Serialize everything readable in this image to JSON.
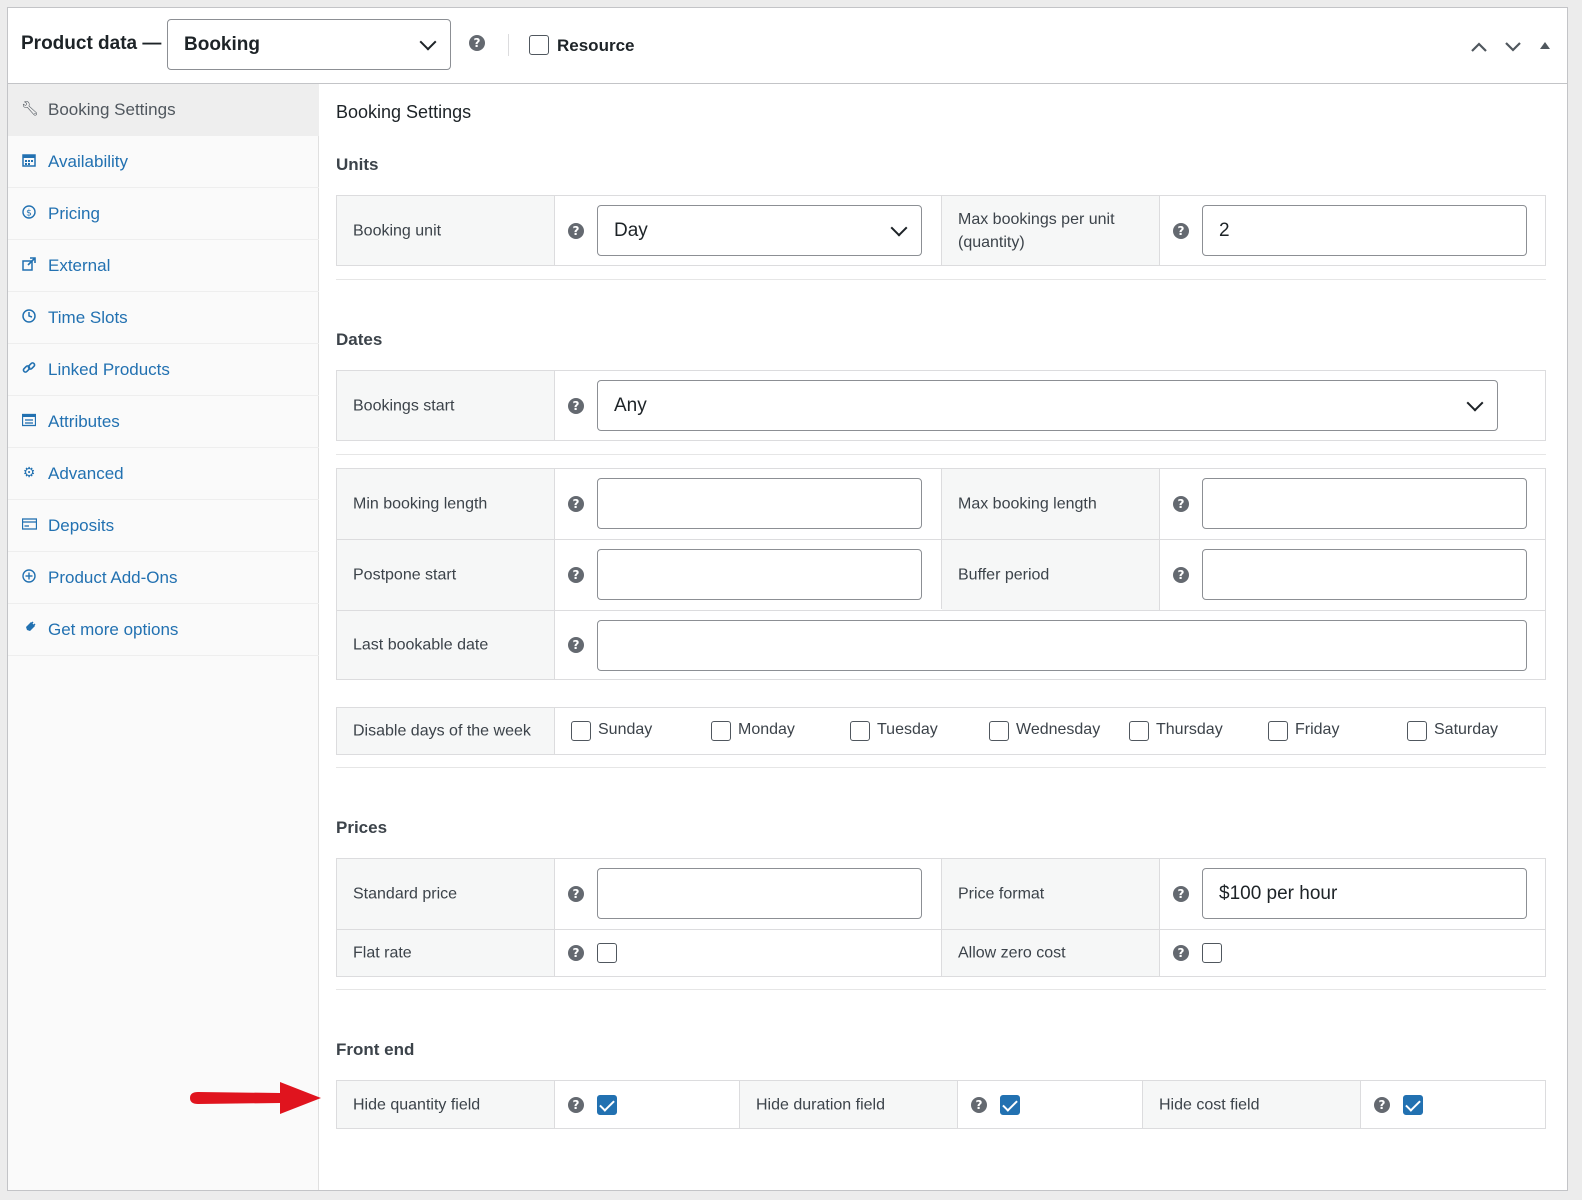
{
  "header": {
    "title": "Product data —",
    "product_type": "Booking",
    "resource_label": "Resource",
    "resource_checked": false
  },
  "sidebar": {
    "items": [
      {
        "label": "Booking Settings",
        "icon": "wrench-icon",
        "active": true
      },
      {
        "label": "Availability",
        "icon": "calendar-icon"
      },
      {
        "label": "Pricing",
        "icon": "dollar-icon"
      },
      {
        "label": "External",
        "icon": "external-link-icon"
      },
      {
        "label": "Time Slots",
        "icon": "clock-icon"
      },
      {
        "label": "Linked Products",
        "icon": "link-icon"
      },
      {
        "label": "Attributes",
        "icon": "list-icon"
      },
      {
        "label": "Advanced",
        "icon": "gear-icon"
      },
      {
        "label": "Deposits",
        "icon": "card-icon"
      },
      {
        "label": "Product Add-Ons",
        "icon": "plus-circle-icon"
      },
      {
        "label": "Get more options",
        "icon": "plugin-icon"
      }
    ]
  },
  "main": {
    "title": "Booking Settings",
    "units": {
      "heading": "Units",
      "booking_unit_label": "Booking unit",
      "booking_unit_value": "Day",
      "max_bookings_label": "Max bookings per unit (quantity)",
      "max_bookings_value": "2"
    },
    "dates": {
      "heading": "Dates",
      "bookings_start_label": "Bookings start",
      "bookings_start_value": "Any",
      "min_length_label": "Min booking length",
      "max_length_label": "Max booking length",
      "postpone_label": "Postpone start",
      "buffer_label": "Buffer period",
      "last_date_label": "Last bookable date",
      "disable_days_label": "Disable days of the week",
      "days": [
        "Sunday",
        "Monday",
        "Tuesday",
        "Wednesday",
        "Thursday",
        "Friday",
        "Saturday"
      ]
    },
    "prices": {
      "heading": "Prices",
      "standard_price_label": "Standard price",
      "price_format_label": "Price format",
      "price_format_value": "$100 per hour",
      "flat_rate_label": "Flat rate",
      "flat_rate_checked": false,
      "allow_zero_label": "Allow zero cost",
      "allow_zero_checked": false
    },
    "front_end": {
      "heading": "Front end",
      "hide_quantity_label": "Hide quantity field",
      "hide_quantity_checked": true,
      "hide_duration_label": "Hide duration field",
      "hide_duration_checked": true,
      "hide_cost_label": "Hide cost field",
      "hide_cost_checked": true
    }
  },
  "colors": {
    "link": "#2271b1",
    "annotation_arrow": "#e0141e"
  }
}
